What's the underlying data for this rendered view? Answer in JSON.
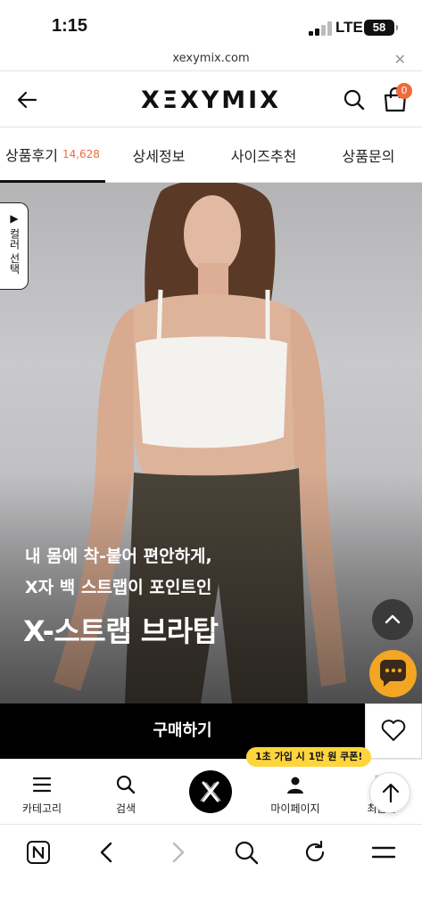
{
  "status_bar": {
    "time": "1:15",
    "network": "LTE",
    "battery": "58"
  },
  "browser": {
    "url": "xexymix.com"
  },
  "header": {
    "logo": "XΞXYMIX",
    "cart_count": "0"
  },
  "tabs": [
    {
      "label": "상품후기",
      "count": "14,628",
      "active": true
    },
    {
      "label": "상세정보",
      "active": false
    },
    {
      "label": "사이즈추천",
      "active": false
    },
    {
      "label": "상품문의",
      "active": false
    }
  ],
  "hero": {
    "color_select_label": "▶ 컬러 선택",
    "subtitle_line1": "내 몸에 착-붙어 편안하게,",
    "subtitle_line2": "X자 백 스트랩이 포인트인",
    "title": "X-스트랩 브라탑"
  },
  "buy_bar": {
    "buy_label": "구매하기"
  },
  "bottom_nav": {
    "coupon_badge": "1초 가입 시 1만 원 쿠폰!",
    "items": [
      {
        "label": "카테고리",
        "icon": "menu-icon"
      },
      {
        "label": "검색",
        "icon": "search-icon"
      },
      {
        "label": "",
        "icon": "brand-x-icon"
      },
      {
        "label": "마이페이지",
        "icon": "user-icon"
      },
      {
        "label": "최근본",
        "icon": "recent-icon"
      }
    ]
  },
  "colors": {
    "accent": "#f06a3a",
    "buy_button": "#000000",
    "chat_button": "#f2a623",
    "coupon_badge": "#ffd53d"
  }
}
